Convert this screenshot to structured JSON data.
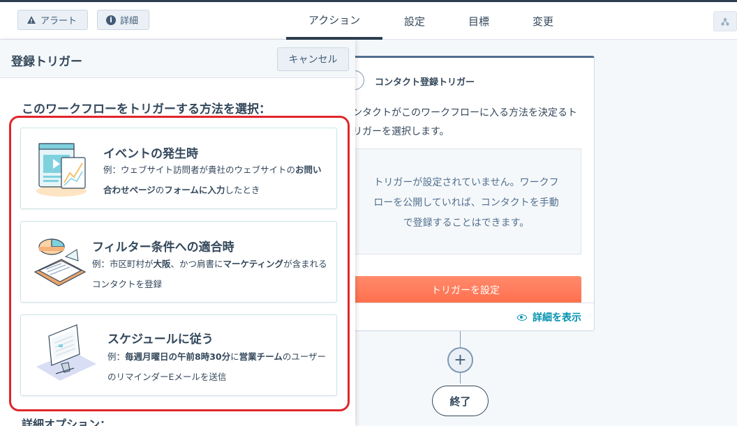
{
  "topbar": {
    "alert_label": "アラート",
    "details_label": "詳細",
    "tabs": [
      {
        "label": "アクション",
        "active": true
      },
      {
        "label": "設定",
        "active": false
      },
      {
        "label": "目標",
        "active": false
      },
      {
        "label": "変更",
        "active": false
      }
    ]
  },
  "panel": {
    "title": "登録トリガー",
    "cancel_label": "キャンセル",
    "question": "このワークフローをトリガーする方法を選択：",
    "options": [
      {
        "title": "イベントの発生時",
        "desc_parts": [
          "例：ウェブサイト訪問者が貴社のウェブサイトの",
          "お問い合わせページ",
          "の",
          "フォームに入力",
          "したとき"
        ]
      },
      {
        "title": "フィルター条件への適合時",
        "desc_parts": [
          "例：市区町村が",
          "大阪",
          "、かつ肩書に",
          "マーケティング",
          "が含まれるコンタクトを登録"
        ]
      },
      {
        "title": "スケジュールに従う",
        "desc_parts": [
          "例：",
          "毎週月曜日の午前8時30分",
          "に",
          "営業チーム",
          "のユーザーのリマインダーEメールを送信"
        ]
      }
    ],
    "more_options": "詳細オプション："
  },
  "card": {
    "title": "コンタクト登録トリガー",
    "description": "ンタクトがこのワークフローに入る方法を決定るトリガーを選択します。",
    "empty_message": "トリガーが設定されていません。ワークフローを公開していれば、コンタクトを手動で登録することはできます。",
    "set_trigger_label": "トリガーを設定",
    "show_details_label": "詳細を表示"
  },
  "flow": {
    "plus_symbol": "+",
    "end_label": "終了"
  },
  "colors": {
    "highlight": "#e0262a",
    "primary_button": "#ff7a59",
    "link": "#0091ae",
    "text": "#33475b"
  }
}
